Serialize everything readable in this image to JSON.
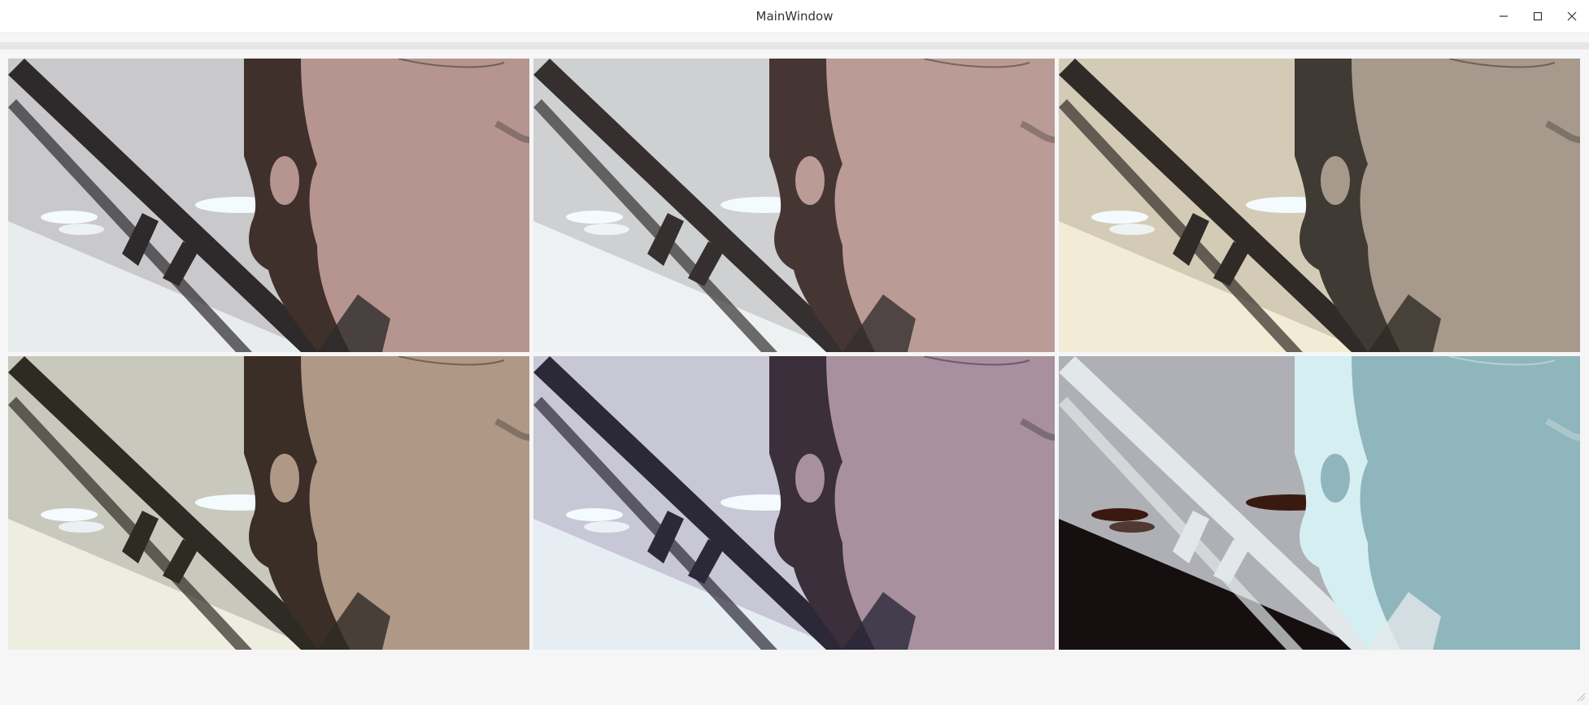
{
  "window": {
    "title": "MainWindow",
    "controls": {
      "minimize_icon": "minimize-icon",
      "maximize_icon": "maximize-icon",
      "close_icon": "close-icon"
    }
  },
  "video_grid": {
    "rows": 2,
    "columns": 3,
    "frames": [
      {
        "filter": "original",
        "colors": {
          "ceiling": "#c9c9cc",
          "skin": "#b6948f",
          "hair": "#3f302c",
          "wall": "#e8ecec",
          "shadow": "#2e2a2c"
        }
      },
      {
        "filter": "smooth",
        "colors": {
          "ceiling": "#cfd0d2",
          "skin": "#bb9b96",
          "hair": "#463633",
          "wall": "#eef1f1",
          "shadow": "#35302f"
        }
      },
      {
        "filter": "sepia",
        "colors": {
          "ceiling": "#d4cbb6",
          "skin": "#a7998b",
          "hair": "#3f3a33",
          "wall": "#f2ecd6",
          "shadow": "#302b26"
        }
      },
      {
        "filter": "warm",
        "colors": {
          "ceiling": "#c9c8bd",
          "skin": "#b09886",
          "hair": "#3a2e27",
          "wall": "#eeeee0",
          "shadow": "#2e2b24"
        }
      },
      {
        "filter": "cool",
        "colors": {
          "ceiling": "#c8c7d6",
          "skin": "#a8909f",
          "hair": "#3a2f3a",
          "wall": "#e7eef3",
          "shadow": "#2b2838"
        }
      },
      {
        "filter": "invert",
        "colors": {
          "ceiling": "#aeb0b6",
          "skin": "#8fb6bc",
          "hair": "#d5eef2",
          "wall": "#160f10",
          "shadow": "#e2e8ea"
        }
      }
    ]
  }
}
